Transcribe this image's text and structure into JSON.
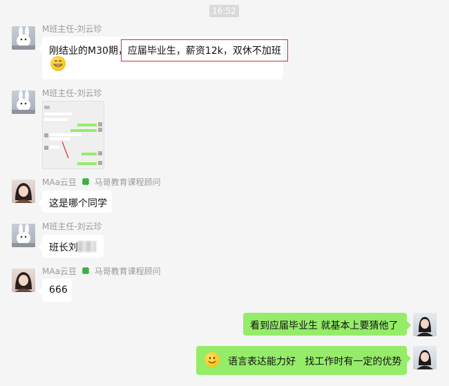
{
  "timestamp": "16:52",
  "messages": [
    {
      "sender": "M班主任-刘云珍",
      "text_a": "刚结业的M30期，",
      "text_b": "应届毕业生，薪资12k，双休不加班"
    },
    {
      "sender": "M班主任-刘云珍"
    },
    {
      "sender_a": "MAa云豆",
      "sender_b": "马哥教育课程顾问",
      "text": "这是哪个同学"
    },
    {
      "sender": "M班主任-刘云珍",
      "text": "班长刘"
    },
    {
      "sender_a": "MAa云豆",
      "sender_b": "马哥教育课程顾问",
      "text": "666"
    },
    {
      "text": "看到应届毕业生 就基本上要猜他了"
    },
    {
      "text": "语言表达能力好   找工作时有一定的优势"
    }
  ],
  "colors": {
    "accent_green": "#95ec69",
    "highlight": "#c8323a"
  }
}
